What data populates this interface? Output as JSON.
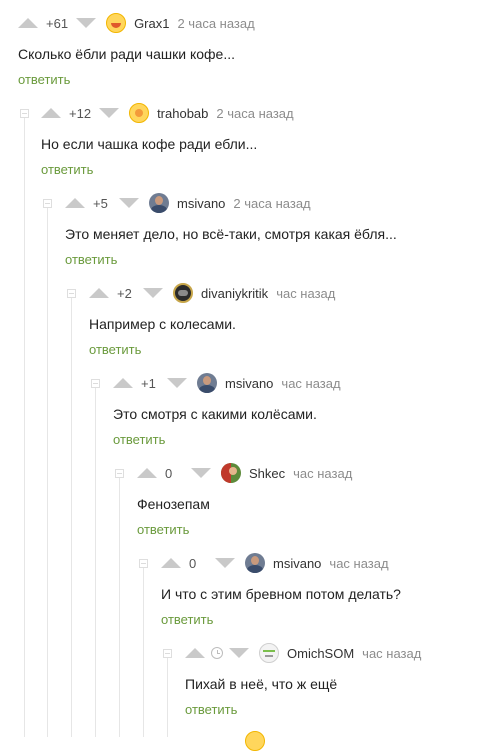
{
  "comments": [
    {
      "rating": "+61",
      "author": "Grax1",
      "time": "2 часа назад",
      "text": "Сколько ёбли ради чашки кофе...",
      "reply": "ответить"
    },
    {
      "rating": "+12",
      "author": "trahobab",
      "time": "2 часа назад",
      "text": "Но если чашка кофе ради ебли...",
      "reply": "ответить"
    },
    {
      "rating": "+5",
      "author": "msivano",
      "time": "2 часа назад",
      "text": "Это меняет дело, но всё-таки, смотря какая ёбля...",
      "reply": "ответить"
    },
    {
      "rating": "+2",
      "author": "divaniykritik",
      "time": "час назад",
      "text": "Например с колесами.",
      "reply": "ответить"
    },
    {
      "rating": "+1",
      "author": "msivano",
      "time": "час назад",
      "text": "Это смотря с какими колёсами.",
      "reply": "ответить"
    },
    {
      "rating": "0",
      "author": "Shkec",
      "time": "час назад",
      "text": "Фенозепам",
      "reply": "ответить"
    },
    {
      "rating": "0",
      "author": "msivano",
      "time": "час назад",
      "text": "И что с этим бревном потом делать?",
      "reply": "ответить"
    },
    {
      "rating": "",
      "author": "OmichSOM",
      "time": "час назад",
      "text": "Пихай в неё, что ж ещё",
      "reply": "ответить"
    }
  ],
  "icons": {
    "upvote": "arrow-up-icon",
    "downvote": "arrow-down-icon",
    "pending_rating": "clock-icon",
    "collapse": "collapse-icon"
  },
  "colors": {
    "reply_link": "#6a9a3c",
    "meta_text": "#8c8c8c",
    "vote_arrow": "#c9c9c9",
    "thread_line": "#e6e6e6"
  }
}
